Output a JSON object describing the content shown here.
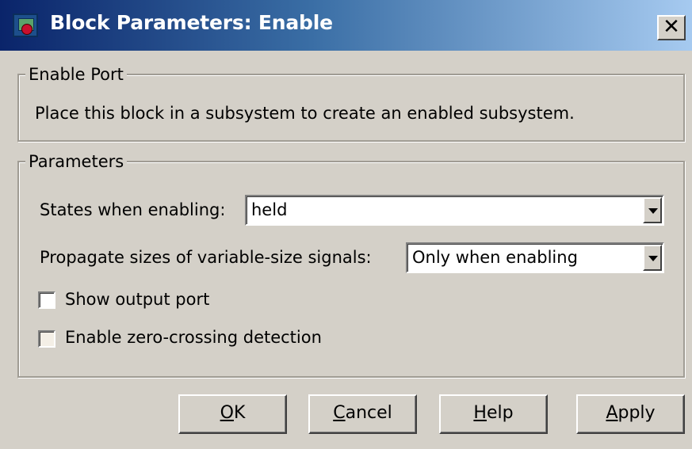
{
  "window": {
    "title": "Block Parameters: Enable",
    "close_label": "✕"
  },
  "enable_port": {
    "group_title": "Enable Port",
    "description": "Place this block in a subsystem to create an enabled subsystem."
  },
  "parameters": {
    "group_title": "Parameters",
    "states_label": "States when enabling:",
    "states_value": "held",
    "propagate_label": "Propagate sizes of variable-size signals:",
    "propagate_value": "Only when enabling",
    "show_output_port_label": "Show output port",
    "show_output_port_checked": false,
    "zero_crossing_label": "Enable zero-crossing detection",
    "zero_crossing_checked": false
  },
  "buttons": {
    "ok": {
      "mnemonic": "O",
      "rest": "K"
    },
    "cancel": {
      "mnemonic": "C",
      "rest": "ancel"
    },
    "help": {
      "mnemonic": "H",
      "rest": "elp"
    },
    "apply": {
      "mnemonic": "A",
      "rest": "pply"
    }
  }
}
